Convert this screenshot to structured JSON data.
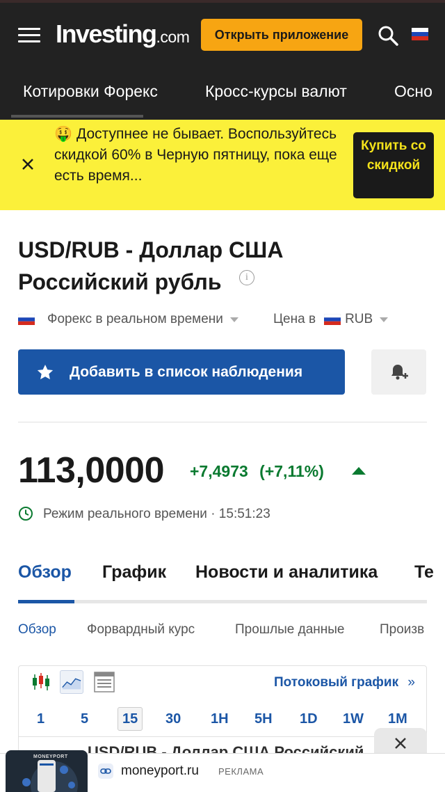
{
  "header": {
    "logo_main": "Investing",
    "logo_domain": ".com",
    "open_app_label": "Открыть приложение"
  },
  "nav_tabs": [
    "Котировки Форекс",
    "Кросс-курсы валют",
    "Осно"
  ],
  "promo": {
    "emoji": "🤑",
    "text": "Доступнее не бывает. Воспользуйтесь скидкой 60% в Черную пятницу, пока еще есть время...",
    "buy_label": "Купить со скидкой"
  },
  "instrument": {
    "title": "USD/RUB - Доллар США Российский рубль",
    "market_label": "Форекс в реальном времени",
    "price_in_label": "Цена в",
    "currency": "RUB",
    "watchlist_label": "Добавить в список наблюдения"
  },
  "quote": {
    "price": "113,0000",
    "change": "+7,4973",
    "change_pct": "(+7,11%)",
    "realtime_label": "Режим реального времени · 15:51:23"
  },
  "main_tabs": [
    "Обзор",
    "График",
    "Новости и аналитика",
    "Те"
  ],
  "sub_tabs": [
    "Обзор",
    "Форвардный курс",
    "Прошлые данные",
    "Произв"
  ],
  "chart_widget": {
    "stream_link": "Потоковый график",
    "stream_chevron": "»",
    "timeframes": [
      "1",
      "5",
      "15",
      "30",
      "1H",
      "5H",
      "1D",
      "1W",
      "1M"
    ],
    "selected_timeframe": "15"
  },
  "behind_text": "USD/RUB - Доллар США Российский",
  "ad": {
    "thumb_brand": "MONEYPORT",
    "domain": "moneyport.ru",
    "label": "РЕКЛАМА"
  },
  "colors": {
    "header_bg": "#222222",
    "accent_orange": "#f7a512",
    "promo_yellow": "#fbf03a",
    "primary_blue": "#1b56a6",
    "positive_green": "#0a7a30"
  }
}
